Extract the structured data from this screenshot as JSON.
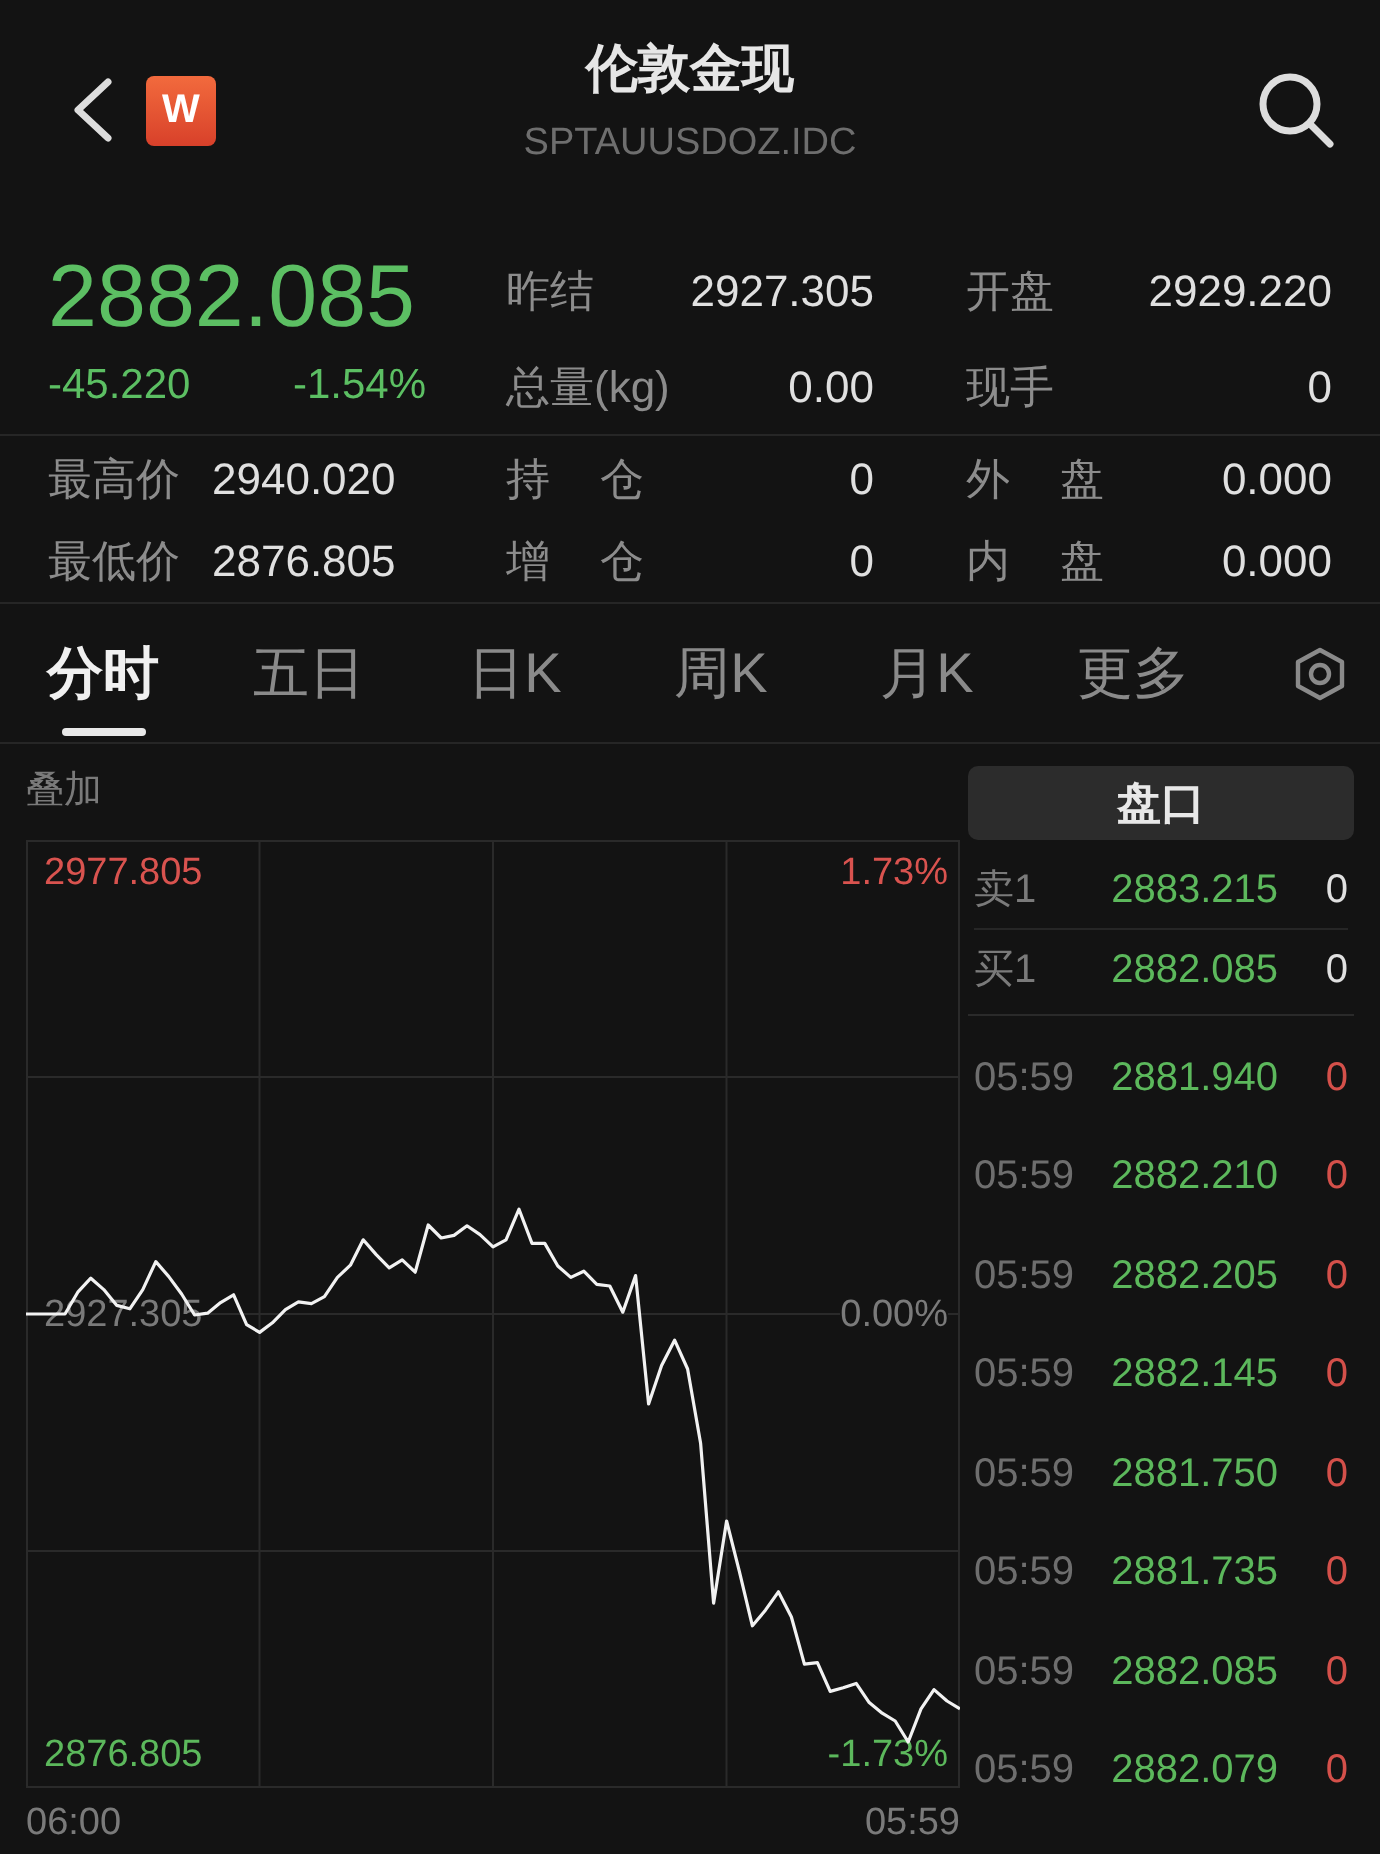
{
  "header": {
    "logo": "W",
    "title": "伦敦金现",
    "code": "SPTAUUSDOZ.IDC"
  },
  "quote": {
    "price": "2882.085",
    "change": "-45.220",
    "change_pct": "-1.54%",
    "falling": true,
    "stats": [
      {
        "label": "昨结",
        "value": "2927.305"
      },
      {
        "label": "开盘",
        "value": "2929.220"
      },
      {
        "label": "总量(kg)",
        "value": "0.00"
      },
      {
        "label": "现手",
        "value": "0"
      }
    ],
    "range_stats": [
      {
        "label": "最高价",
        "value": "2940.020"
      },
      {
        "label": "持 仓",
        "value": "0"
      },
      {
        "label": "外 盘",
        "value": "0.000"
      },
      {
        "label": "最低价",
        "value": "2876.805"
      },
      {
        "label": "增 仓",
        "value": "0"
      },
      {
        "label": "内 盘",
        "value": "0.000"
      }
    ]
  },
  "tabs": [
    {
      "label": "分时",
      "selected": true
    },
    {
      "label": "五日",
      "selected": false
    },
    {
      "label": "日K",
      "selected": false
    },
    {
      "label": "周K",
      "selected": false
    },
    {
      "label": "月K",
      "selected": false
    },
    {
      "label": "更多",
      "selected": false
    }
  ],
  "chart": {
    "overlay_button": "叠加",
    "percent_labels": [
      {
        "text": "1.73%",
        "color": "#d9534f"
      },
      {
        "text": "0.00%",
        "color": "#7a7a7a"
      },
      {
        "text": "-1.73%",
        "color": "#5cb85c"
      }
    ],
    "chart_data": {
      "type": "line",
      "grid": true,
      "series": [
        {
          "color": "#f2f2f2",
          "values": [
            2927.3,
            2927.3,
            2927.3,
            2927.3,
            2929.8,
            2931.4,
            2930.1,
            2928.3,
            2927.9,
            2930.1,
            2933.3,
            2931.6,
            2929.6,
            2927.2,
            2927.4,
            2928.6,
            2929.5,
            2926.1,
            2925.2,
            2926.3,
            2927.8,
            2928.7,
            2928.5,
            2929.3,
            2931.5,
            2932.9,
            2935.8,
            2934.1,
            2932.6,
            2933.5,
            2932.1,
            2937.5,
            2936.0,
            2936.3,
            2937.4,
            2936.4,
            2935.0,
            2935.8,
            2939.3,
            2935.4,
            2935.4,
            2932.8,
            2931.5,
            2932.2,
            2930.7,
            2930.5,
            2927.5,
            2931.7,
            2917.0,
            2921.4,
            2924.3,
            2921.0,
            2912.5,
            2894.2,
            2903.6,
            2897.8,
            2891.6,
            2893.4,
            2895.5,
            2892.6,
            2887.2,
            2887.4,
            2884.1,
            2884.5,
            2885.0,
            2882.8,
            2881.6,
            2880.7,
            2878.3,
            2882.1,
            2884.3,
            2883.0,
            2882.1
          ]
        }
      ],
      "ylim": [
        2873.03,
        2981.58
      ],
      "yticks": [
        {
          "value": 2977.805,
          "label": "2977.805"
        },
        {
          "value": 2927.305,
          "label": "2927.305"
        },
        {
          "value": 2876.805,
          "label": "2876.805"
        }
      ]
    },
    "time_axis_labels": [
      "06:00",
      "05:59"
    ]
  },
  "order_panel": {
    "title": "盘口",
    "book": [
      {
        "side": "卖1",
        "price": "2883.215",
        "volume": "0"
      },
      {
        "side": "买1",
        "price": "2882.085",
        "volume": "0"
      }
    ],
    "trades": [
      {
        "time": "05:59",
        "price": "2881.940",
        "volume": "0"
      },
      {
        "time": "05:59",
        "price": "2882.210",
        "volume": "0"
      },
      {
        "time": "05:59",
        "price": "2882.205",
        "volume": "0"
      },
      {
        "time": "05:59",
        "price": "2882.145",
        "volume": "0"
      },
      {
        "time": "05:59",
        "price": "2881.750",
        "volume": "0"
      },
      {
        "time": "05:59",
        "price": "2881.735",
        "volume": "0"
      },
      {
        "time": "05:59",
        "price": "2882.085",
        "volume": "0"
      },
      {
        "time": "05:59",
        "price": "2882.079",
        "volume": "0"
      }
    ]
  }
}
